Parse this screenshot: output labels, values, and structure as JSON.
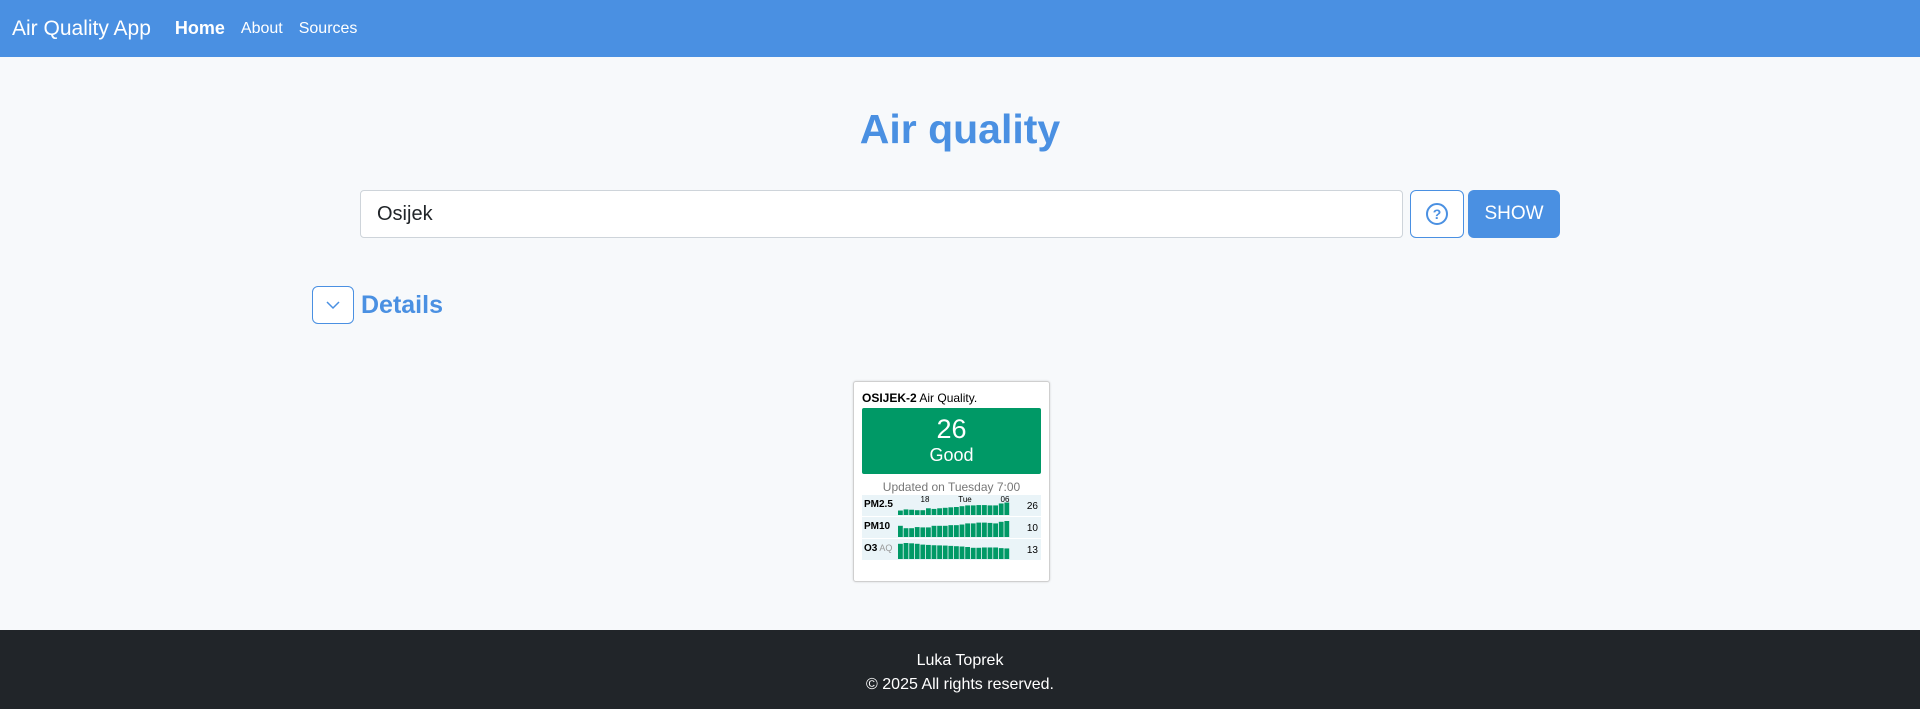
{
  "navbar": {
    "brand": "Air Quality App",
    "links": [
      {
        "label": "Home",
        "active": true
      },
      {
        "label": "About",
        "active": false
      },
      {
        "label": "Sources",
        "active": false
      }
    ]
  },
  "page": {
    "title": "Air quality"
  },
  "search": {
    "value": "Osijek",
    "help_icon": "question-circle-icon",
    "show_label": "SHOW"
  },
  "details": {
    "title": "Details",
    "toggle_icon": "chevron-down-icon"
  },
  "widget": {
    "station": "OSIJEK-2",
    "header_suffix": " Air Quality.",
    "aqi": "26",
    "level": "Good",
    "level_color": "#009966",
    "updated": "Updated on Tuesday 7:00",
    "tick_labels": [
      "18",
      "Tue",
      "06"
    ],
    "bar_color": "#009966",
    "pollutants": [
      {
        "name": "PM2.5",
        "sub": "",
        "value": "26",
        "bars": [
          0.28,
          0.35,
          0.33,
          0.3,
          0.3,
          0.42,
          0.38,
          0.42,
          0.45,
          0.48,
          0.5,
          0.55,
          0.6,
          0.6,
          0.62,
          0.62,
          0.6,
          0.6,
          0.72,
          0.78
        ]
      },
      {
        "name": "PM10",
        "sub": "",
        "value": "10",
        "bars": [
          0.7,
          0.55,
          0.55,
          0.62,
          0.6,
          0.6,
          0.7,
          0.7,
          0.7,
          0.74,
          0.74,
          0.78,
          0.85,
          0.85,
          0.9,
          0.9,
          0.88,
          0.85,
          0.95,
          1.0
        ]
      },
      {
        "name": "O3",
        "sub": " AQ",
        "value": "13",
        "bars": [
          0.95,
          1.0,
          0.98,
          0.95,
          0.9,
          0.88,
          0.86,
          0.85,
          0.84,
          0.82,
          0.8,
          0.78,
          0.75,
          0.7,
          0.7,
          0.72,
          0.72,
          0.72,
          0.68,
          0.66
        ]
      }
    ]
  },
  "footer": {
    "author": "Luka Toprek",
    "copyright": "© 2025 All rights reserved."
  }
}
